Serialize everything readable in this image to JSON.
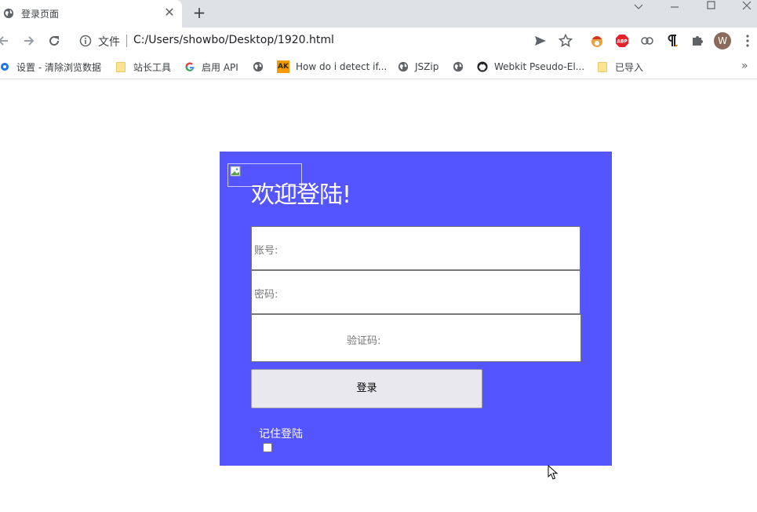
{
  "browser": {
    "tab_title": "登录页面",
    "tab_close": "✕",
    "new_tab": "+",
    "scheme": "文件",
    "url": "C:/Users/showbo/Desktop/1920.html",
    "profile_initial": "W"
  },
  "bookmarks": [
    {
      "label": "设置 - 清除浏览数据",
      "icon": "gear-icon"
    },
    {
      "label": "站长工具",
      "icon": "folder-icon"
    },
    {
      "label": "启用 API",
      "icon": "google-icon"
    },
    {
      "label": "",
      "icon": "globe-icon"
    },
    {
      "label": "How do i detect if...",
      "icon": "ak-icon"
    },
    {
      "label": "JSZip",
      "icon": "globe-icon"
    },
    {
      "label": "Webkit Pseudo-El...",
      "icon": "github-icon"
    },
    {
      "label": "已导入",
      "icon": "folder-icon"
    }
  ],
  "bookmarks_more": "»",
  "ak_badge": "AK",
  "login": {
    "title": "欢迎登陆!",
    "account_label": "账号:",
    "password_label": "密码:",
    "captcha_label": "验证码:",
    "submit_label": "登录",
    "remember_label": "记住登陆",
    "remember_checked": false
  },
  "colors": {
    "panel": "#5555ff",
    "button": "#e9e9ed"
  }
}
